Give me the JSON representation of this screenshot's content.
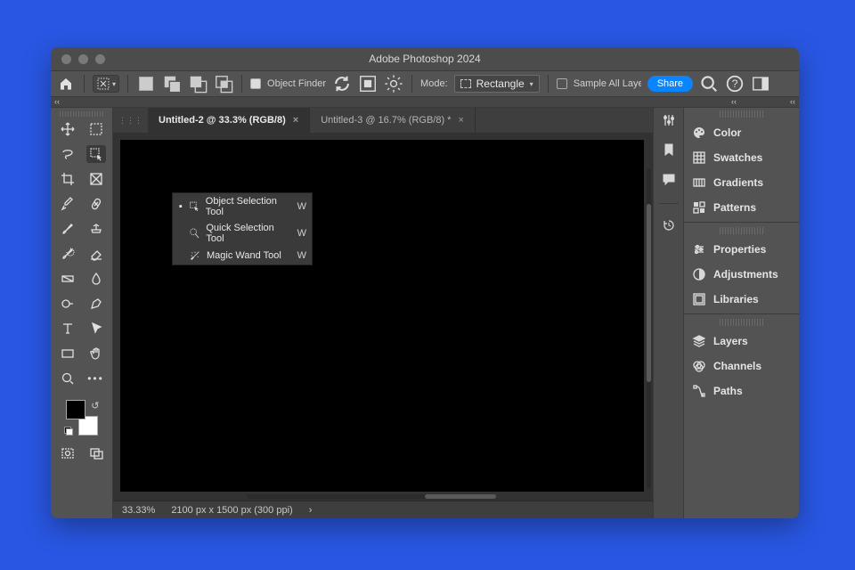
{
  "title": "Adobe Photoshop 2024",
  "optionsbar": {
    "object_finder_label": "Object Finder",
    "mode_label": "Mode:",
    "mode_value": "Rectangle",
    "sample_all_label": "Sample All Layers",
    "share_label": "Share"
  },
  "tabs": [
    {
      "label": "Untitled-2 @ 33.3% (RGB/8)",
      "active": true
    },
    {
      "label": "Untitled-3 @ 16.7% (RGB/8) *",
      "active": false
    }
  ],
  "status": {
    "zoom": "33.33%",
    "dims": "2100 px x 1500 px (300 ppi)",
    "arrow": "›"
  },
  "flyout": [
    {
      "label": "Object Selection Tool",
      "shortcut": "W",
      "selected": true
    },
    {
      "label": "Quick Selection Tool",
      "shortcut": "W",
      "selected": false
    },
    {
      "label": "Magic Wand Tool",
      "shortcut": "W",
      "selected": false
    }
  ],
  "panels": {
    "group1": [
      "Color",
      "Swatches",
      "Gradients",
      "Patterns"
    ],
    "group2": [
      "Properties",
      "Adjustments",
      "Libraries"
    ],
    "group3": [
      "Layers",
      "Channels",
      "Paths"
    ]
  },
  "colors": {
    "bg_page": "#2957e3",
    "accent": "#0a84ff"
  }
}
